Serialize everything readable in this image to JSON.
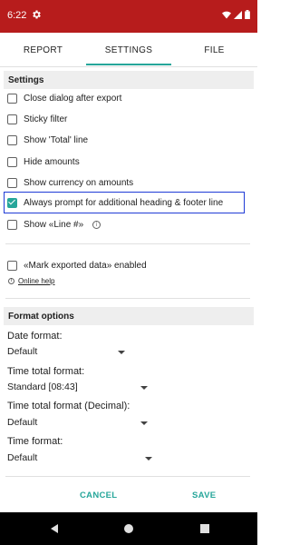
{
  "status_bar": {
    "time": "6:22"
  },
  "tabs": [
    {
      "label": "REPORT"
    },
    {
      "label": "SETTINGS"
    },
    {
      "label": "FILE"
    }
  ],
  "settings": {
    "header": "Settings",
    "options": [
      {
        "label": "Close dialog after export",
        "checked": false
      },
      {
        "label": "Sticky filter",
        "checked": false
      },
      {
        "label": "Show 'Total' line",
        "checked": false
      },
      {
        "label": "Hide amounts",
        "checked": false
      },
      {
        "label": "Show currency on amounts",
        "checked": false
      },
      {
        "label": "Always prompt for additional heading & footer line",
        "checked": true
      },
      {
        "label": "Show «Line #»",
        "checked": false
      }
    ],
    "mark_exported": {
      "label": "«Mark exported data» enabled",
      "checked": false
    },
    "online_help": "Online help"
  },
  "format_options": {
    "header": "Format options",
    "fields": [
      {
        "label": "Date format:",
        "value": "Default"
      },
      {
        "label": "Time total format:",
        "value": "Standard [08:43]"
      },
      {
        "label": "Time total format (Decimal):",
        "value": "Default"
      },
      {
        "label": "Time format:",
        "value": "Default"
      }
    ]
  },
  "actions": {
    "cancel": "CANCEL",
    "save": "SAVE"
  },
  "colors": {
    "status_bar": "#b71c1c",
    "accent": "#26a69a",
    "highlight_border": "#1f3bd6"
  }
}
